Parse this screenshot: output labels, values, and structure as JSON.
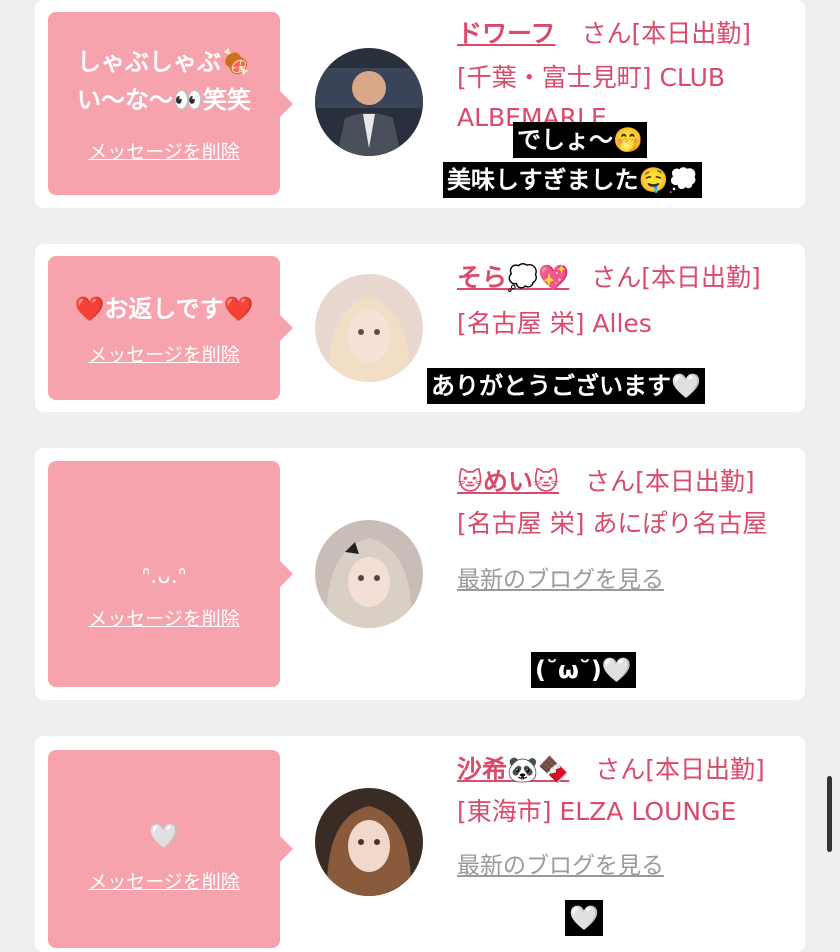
{
  "cards": [
    {
      "message": "しゃぶしゃぶ🍖\nい〜な〜👀笑笑",
      "delete_label": "メッセージを削除",
      "name": "ドワーフ",
      "san": "さん[本日出勤]",
      "shop": "[千葉・富士見町] CLUB ALBEMARLE",
      "overlay1": "でしょ〜🤭",
      "overlay2": "美味しすぎました🤤💭"
    },
    {
      "message": "❤️お返しです❤️",
      "delete_label": "メッセージを削除",
      "name": "そら💭💖",
      "san": "さん[本日出勤]",
      "shop": "[名古屋 栄] Alles",
      "overlay1": "ありがとうございます🤍"
    },
    {
      "message": "ᐢ.ᴗ.ᐢ",
      "delete_label": "メッセージを削除",
      "name": "🐱めい🐱",
      "san": "さん[本日出勤]",
      "shop": "[名古屋 栄] あにぽり名古屋",
      "blog": "最新のブログを見る",
      "overlay1": "(˘ω˘)🤍"
    },
    {
      "message": "🤍",
      "delete_label": "メッセージを削除",
      "name": "沙希🐼🍫",
      "san": "さん[本日出勤]",
      "shop": "[東海市] ELZA LOUNGE",
      "blog": "最新のブログを見る",
      "overlay1": "🤍"
    }
  ],
  "colors": {
    "bubble": "#f7a3ae",
    "accent": "#d94a6b",
    "background": "#efefef"
  }
}
